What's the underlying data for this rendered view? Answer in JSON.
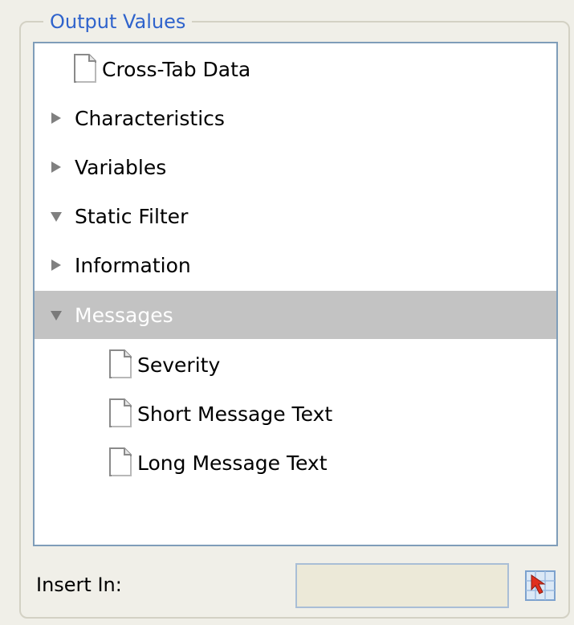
{
  "group": {
    "title": "Output Values"
  },
  "tree": {
    "items": [
      {
        "label": "Cross-Tab Data",
        "icon": "document-icon"
      },
      {
        "label": "Characteristics",
        "icon": "expand-arrow-icon"
      },
      {
        "label": "Variables",
        "icon": "expand-arrow-icon"
      },
      {
        "label": "Static Filter",
        "icon": "collapse-arrow-icon"
      },
      {
        "label": "Information",
        "icon": "expand-arrow-icon"
      },
      {
        "label": "Messages",
        "icon": "collapse-arrow-icon",
        "selected": true
      },
      {
        "label": "Severity",
        "icon": "document-icon"
      },
      {
        "label": "Short Message Text",
        "icon": "document-icon"
      },
      {
        "label": "Long Message Text",
        "icon": "document-icon"
      }
    ]
  },
  "insert": {
    "label": "Insert In:",
    "value": ""
  },
  "colors": {
    "accent": "#2f63cc",
    "selection": "#c3c3c3",
    "border": "#7f9db9"
  }
}
